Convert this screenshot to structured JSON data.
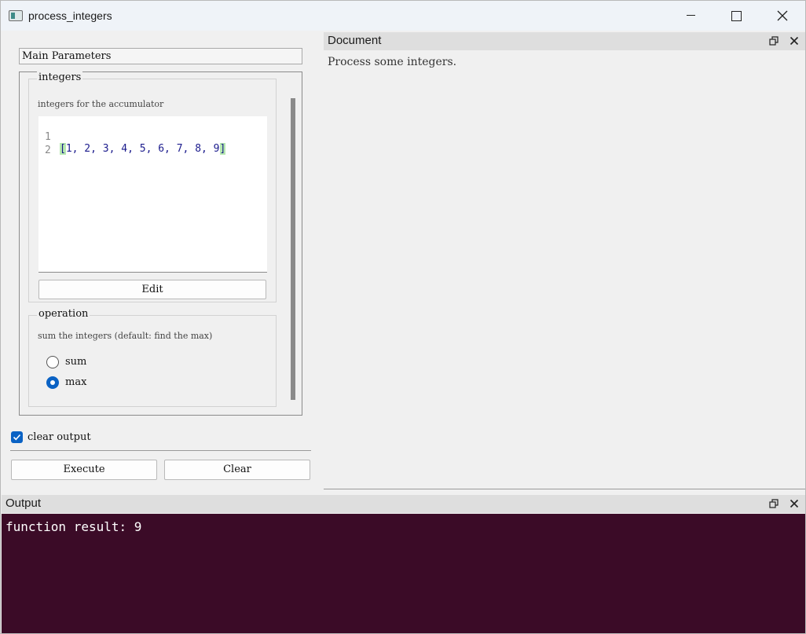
{
  "window": {
    "title": "process_integers"
  },
  "left_panel": {
    "section_title": "Main Parameters",
    "integers_group": {
      "title": "integers",
      "description": "integers for the accumulator",
      "editor_lines": [
        {
          "number": "1",
          "code": "1, 2, 3, 4, 5, 6, 7, 8, 9",
          "open": "[",
          "close": "]"
        },
        {
          "number": "2",
          "code": ""
        }
      ],
      "edit_label": "Edit"
    },
    "operation_group": {
      "title": "operation",
      "description": "sum the integers (default: find the max)",
      "options": [
        {
          "label": "sum",
          "checked": false
        },
        {
          "label": "max",
          "checked": true
        }
      ]
    },
    "clear_output": {
      "label": "clear output",
      "checked": true
    },
    "execute_label": "Execute",
    "clear_label": "Clear"
  },
  "document_dock": {
    "title": "Document",
    "text": "Process some integers."
  },
  "output_dock": {
    "title": "Output",
    "text": "function result: 9",
    "background": "#3b0b27"
  },
  "colors": {
    "accent": "#0a62c4"
  },
  "icons": {
    "float": "restore-icon",
    "close": "close-icon"
  }
}
